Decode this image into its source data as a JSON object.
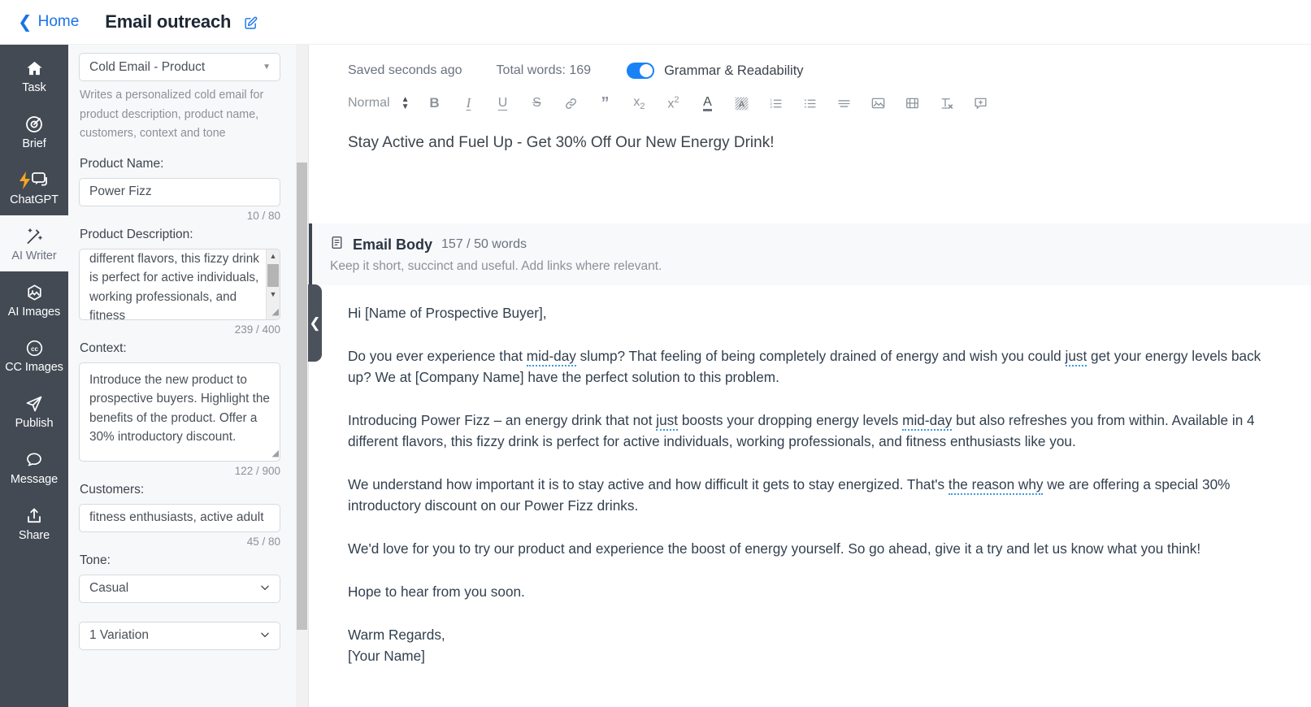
{
  "topbar": {
    "back_label": "Home",
    "doc_title": "Email outreach",
    "edit_icon": "edit-pencil-icon"
  },
  "rail": {
    "items": [
      {
        "label": "Task",
        "icon": "home-icon",
        "active": false
      },
      {
        "label": "Brief",
        "icon": "target-icon",
        "active": false
      },
      {
        "label": "ChatGPT",
        "icon": "lightning-chat-icon",
        "active": false
      },
      {
        "label": "AI Writer",
        "icon": "magic-wand-icon",
        "active": true
      },
      {
        "label": "AI Images",
        "icon": "image-hexagon-icon",
        "active": false
      },
      {
        "label": "CC Images",
        "icon": "creative-commons-icon",
        "active": false
      },
      {
        "label": "Publish",
        "icon": "paper-plane-icon",
        "active": false
      },
      {
        "label": "Message",
        "icon": "speech-bubble-icon",
        "active": false
      },
      {
        "label": "Share",
        "icon": "share-upload-icon",
        "active": false
      }
    ]
  },
  "form": {
    "template_select": {
      "value": "Cold Email - Product",
      "caret_icon": "caret-down-icon"
    },
    "template_description": "Writes a personalized cold email for product description, product name, customers, context and tone",
    "product_name": {
      "label": "Product Name:",
      "value": "Power Fizz",
      "counter": "10 / 80"
    },
    "product_description": {
      "label": "Product Description:",
      "value": "different flavors, this fizzy drink is perfect for active individuals, working professionals, and fitness",
      "counter": "239 / 400"
    },
    "context": {
      "label": "Context:",
      "value": "Introduce the new product to prospective buyers. Highlight the benefits of the product. Offer a 30% introductory discount.",
      "counter": "122 / 900"
    },
    "customers": {
      "label": "Customers:",
      "value": "fitness enthusiasts, active adult",
      "counter": "45 / 80"
    },
    "tone": {
      "label": "Tone:",
      "value": "Casual"
    },
    "variations": {
      "value": "1 Variation"
    }
  },
  "collapse_handle": {
    "icon": "chevron-left-icon"
  },
  "editor": {
    "saved_status": "Saved seconds ago",
    "total_words": "Total words: 169",
    "grammar_toggle_label": "Grammar & Readability",
    "grammar_toggle_on": true,
    "toolbar": {
      "style_value": "Normal",
      "buttons": [
        "bold-icon",
        "italic-icon",
        "underline-icon",
        "strikethrough-icon",
        "link-icon",
        "blockquote-icon",
        "subscript-icon",
        "superscript-icon",
        "text-color-icon",
        "highlight-color-icon",
        "ordered-list-icon",
        "bullet-list-icon",
        "align-icon",
        "image-icon",
        "video-icon",
        "clear-format-icon",
        "add-comment-icon"
      ]
    },
    "subject_line": "Stay Active and Fuel Up - Get 30% Off Our New Energy Drink!",
    "email_body_card": {
      "icon": "document-icon",
      "title": "Email Body",
      "word_count": "157 / 50 words",
      "hint": "Keep it short, succinct and useful. Add links where relevant."
    },
    "body_paragraphs": {
      "greeting": "Hi [Name of Prospective Buyer],",
      "p1_a": "Do you ever experience that ",
      "p1_sug1": "mid-day",
      "p1_b": " slump? That feeling of being completely drained of energy and wish you could ",
      "p1_sug2": "just",
      "p1_c": " get your energy levels back up? We at [Company Name] have the perfect solution to this problem.",
      "p2_a": "Introducing Power Fizz – an energy drink that not ",
      "p2_sug1": "just",
      "p2_b": " boosts your dropping energy levels ",
      "p2_sug2": "mid-day",
      "p2_c": " but also refreshes you from within. Available in 4 different flavors, this fizzy drink is perfect for active individuals, working professionals, and fitness enthusiasts like you.",
      "p3_a": "We understand how important it is to stay active and how difficult it gets to stay energized. That's ",
      "p3_sug1": "the reason why",
      "p3_b": " we are offering a special 30% introductory discount on our Power Fizz drinks.",
      "p4": "We'd love for you to try our product and experience the boost of energy yourself. So go ahead, give it a try and let us know what you think!",
      "p5": "Hope to hear from you soon.",
      "p6": "Warm Regards,",
      "p7": "[Your Name]"
    }
  },
  "colors": {
    "accent_blue": "#1a73e8",
    "toggle_blue": "#1a82f7",
    "rail_bg": "#434a54",
    "panel_bg": "#f7f8fa",
    "suggestion_underline": "#3c9ae0"
  }
}
